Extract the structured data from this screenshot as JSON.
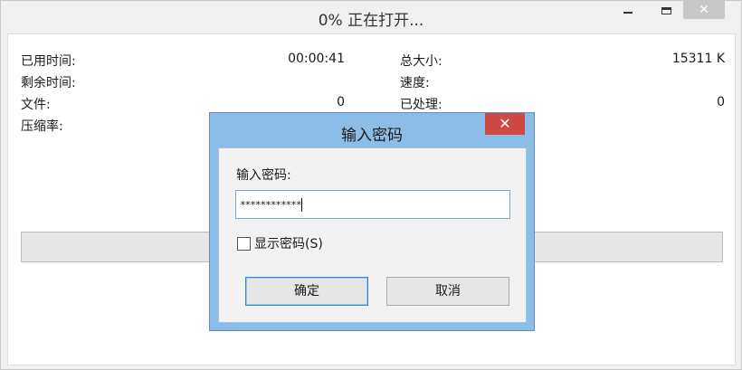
{
  "window": {
    "title": "0% 正在打开...",
    "close_symbol": "✕"
  },
  "stats": {
    "elapsed_label": "已用时间:",
    "elapsed_value": "00:00:41",
    "remaining_label": "剩余时间:",
    "file_label": "文件:",
    "file_value": "0",
    "ratio_label": "压缩率:",
    "total_size_label": "总大小:",
    "total_size_value": "15311 K",
    "speed_label": "速度:",
    "processed_label": "已处理:",
    "processed_value": "0"
  },
  "progress": {
    "fraction": 0
  },
  "dialog": {
    "title": "输入密码",
    "close_symbol": "✕",
    "password_label": "输入密码:",
    "password_masked": "************",
    "show_password_label": "显示密码(S)",
    "show_password_checked": false,
    "ok_label": "确定",
    "cancel_label": "取消"
  },
  "colors": {
    "dialog_frame": "#8cbde8",
    "dialog_close": "#cf4944",
    "window_close": "#c7c7c7",
    "focus_border": "#3d86cf"
  },
  "icons": {
    "minimize": "minimize-icon",
    "maximize": "maximize-icon",
    "close": "close-icon"
  }
}
